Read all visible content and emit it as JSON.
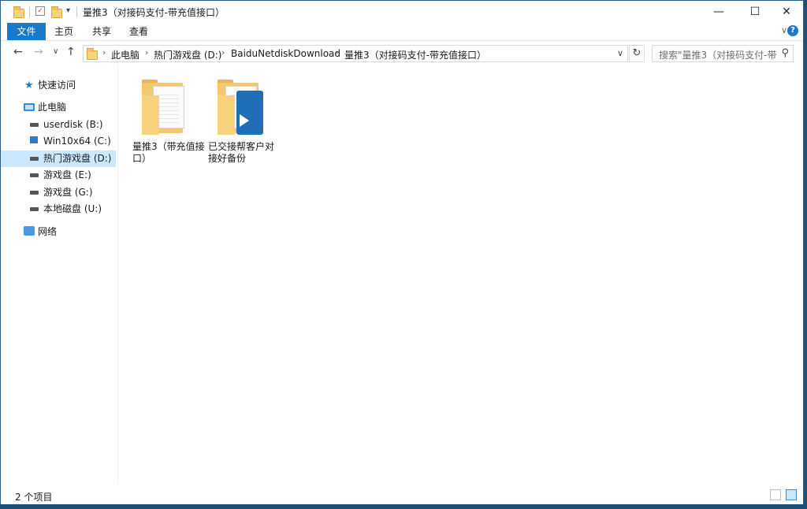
{
  "window": {
    "title": "量推3（对接码支付-带充值接口）"
  },
  "ribbon": {
    "tabs": [
      {
        "label": "文件"
      },
      {
        "label": "主页"
      },
      {
        "label": "共享"
      },
      {
        "label": "查看"
      }
    ]
  },
  "address": {
    "crumbs": [
      "此电脑",
      "热门游戏盘 (D:)",
      "BaiduNetdiskDownload",
      "量推3（对接码支付-带充值接口）"
    ]
  },
  "search": {
    "placeholder": "搜索\"量推3（对接码支付-带..."
  },
  "sidebar": {
    "items": [
      {
        "label": "快速访问"
      },
      {
        "label": "此电脑"
      },
      {
        "label": "userdisk (B:)"
      },
      {
        "label": "Win10x64 (C:)"
      },
      {
        "label": "热门游戏盘 (D:)"
      },
      {
        "label": "游戏盘 (E:)"
      },
      {
        "label": "游戏盘 (G:)"
      },
      {
        "label": "本地磁盘 (U:)"
      },
      {
        "label": "网络"
      }
    ],
    "selected": "热门游戏盘 (D:)"
  },
  "files": [
    {
      "name": "量推3（带充值接口）",
      "icon": "folder-document-icon"
    },
    {
      "name": "已交接帮客户对接好备份",
      "icon": "folder-apk-icon"
    }
  ],
  "status": {
    "count": "2 个项目"
  },
  "colors": {
    "accent": "#1979ca",
    "selection": "#cce8ff",
    "folder": "#f4c86c"
  }
}
